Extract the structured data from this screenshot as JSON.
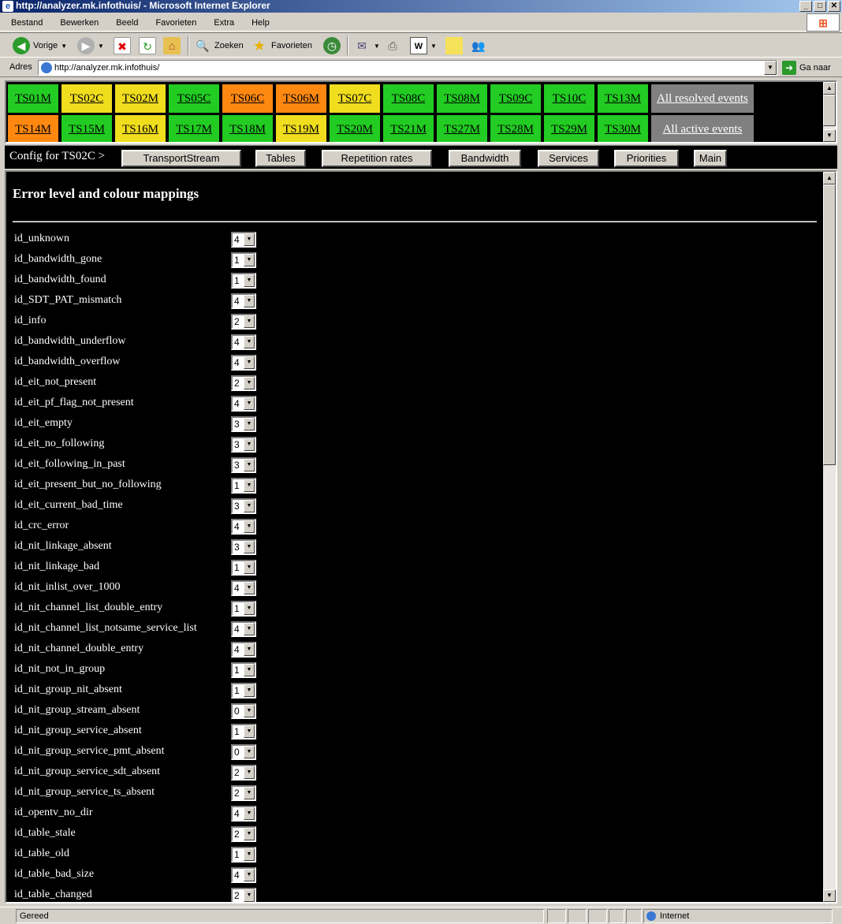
{
  "window": {
    "title": "http://analyzer.mk.infothuis/ - Microsoft Internet Explorer"
  },
  "menu": [
    "Bestand",
    "Bewerken",
    "Beeld",
    "Favorieten",
    "Extra",
    "Help"
  ],
  "toolbar": {
    "back": "Vorige",
    "search": "Zoeken",
    "favorites": "Favorieten"
  },
  "address": {
    "label": "Adres",
    "url": "http://analyzer.mk.infothuis/",
    "go": "Ga naar"
  },
  "streams_row1": [
    {
      "label": "TS01M",
      "color": "g"
    },
    {
      "label": "TS02C",
      "color": "y"
    },
    {
      "label": "TS02M",
      "color": "y"
    },
    {
      "label": "TS05C",
      "color": "g"
    },
    {
      "label": "TS06C",
      "color": "o"
    },
    {
      "label": "TS06M",
      "color": "o"
    },
    {
      "label": "TS07C",
      "color": "y"
    },
    {
      "label": "TS08C",
      "color": "g"
    },
    {
      "label": "TS08M",
      "color": "g"
    },
    {
      "label": "TS09C",
      "color": "g"
    },
    {
      "label": "TS10C",
      "color": "g"
    },
    {
      "label": "TS13M",
      "color": "g"
    }
  ],
  "streams_row2": [
    {
      "label": "TS14M",
      "color": "o"
    },
    {
      "label": "TS15M",
      "color": "g"
    },
    {
      "label": "TS16M",
      "color": "y"
    },
    {
      "label": "TS17M",
      "color": "g"
    },
    {
      "label": "TS18M",
      "color": "g"
    },
    {
      "label": "TS19M",
      "color": "y"
    },
    {
      "label": "TS20M",
      "color": "g"
    },
    {
      "label": "TS21M",
      "color": "g"
    },
    {
      "label": "TS27M",
      "color": "g"
    },
    {
      "label": "TS28M",
      "color": "g"
    },
    {
      "label": "TS29M",
      "color": "g"
    },
    {
      "label": "TS30M",
      "color": "g"
    }
  ],
  "events": {
    "resolved": "All resolved events",
    "active": "All active events"
  },
  "config": {
    "label": "Config for TS02C >",
    "buttons": [
      "TransportStream",
      "Tables",
      "Repetition rates",
      "Bandwidth",
      "Services",
      "Priorities",
      "Main"
    ]
  },
  "main": {
    "heading": "Error level and colour mappings",
    "rows": [
      {
        "label": "id_unknown",
        "value": "4"
      },
      {
        "label": "id_bandwidth_gone",
        "value": "1"
      },
      {
        "label": "id_bandwidth_found",
        "value": "1"
      },
      {
        "label": "id_SDT_PAT_mismatch",
        "value": "4"
      },
      {
        "label": "id_info",
        "value": "2"
      },
      {
        "label": "id_bandwidth_underflow",
        "value": "4"
      },
      {
        "label": "id_bandwidth_overflow",
        "value": "4"
      },
      {
        "label": "id_eit_not_present",
        "value": "2"
      },
      {
        "label": "id_eit_pf_flag_not_present",
        "value": "4"
      },
      {
        "label": "id_eit_empty",
        "value": "3"
      },
      {
        "label": "id_eit_no_following",
        "value": "3"
      },
      {
        "label": "id_eit_following_in_past",
        "value": "3"
      },
      {
        "label": "id_eit_present_but_no_following",
        "value": "1"
      },
      {
        "label": "id_eit_current_bad_time",
        "value": "3"
      },
      {
        "label": "id_crc_error",
        "value": "4"
      },
      {
        "label": "id_nit_linkage_absent",
        "value": "3"
      },
      {
        "label": "id_nit_linkage_bad",
        "value": "1"
      },
      {
        "label": "id_nit_inlist_over_1000",
        "value": "4"
      },
      {
        "label": "id_nit_channel_list_double_entry",
        "value": "1"
      },
      {
        "label": "id_nit_channel_list_notsame_service_list",
        "value": "4"
      },
      {
        "label": "id_nit_channel_double_entry",
        "value": "4"
      },
      {
        "label": "id_nit_not_in_group",
        "value": "1"
      },
      {
        "label": "id_nit_group_nit_absent",
        "value": "1"
      },
      {
        "label": "id_nit_group_stream_absent",
        "value": "0"
      },
      {
        "label": "id_nit_group_service_absent",
        "value": "1"
      },
      {
        "label": "id_nit_group_service_pmt_absent",
        "value": "0"
      },
      {
        "label": "id_nit_group_service_sdt_absent",
        "value": "2"
      },
      {
        "label": "id_nit_group_service_ts_absent",
        "value": "2"
      },
      {
        "label": "id_opentv_no_dir",
        "value": "4"
      },
      {
        "label": "id_table_stale",
        "value": "2"
      },
      {
        "label": "id_table_old",
        "value": "1"
      },
      {
        "label": "id_table_bad_size",
        "value": "4"
      },
      {
        "label": "id_table_changed",
        "value": "2"
      }
    ]
  },
  "status": {
    "text": "Gereed",
    "zone": "Internet"
  },
  "colors": {
    "green": "#22cc22",
    "yellow": "#f0dd1e",
    "orange": "#ff8811",
    "gray": "#808080"
  }
}
